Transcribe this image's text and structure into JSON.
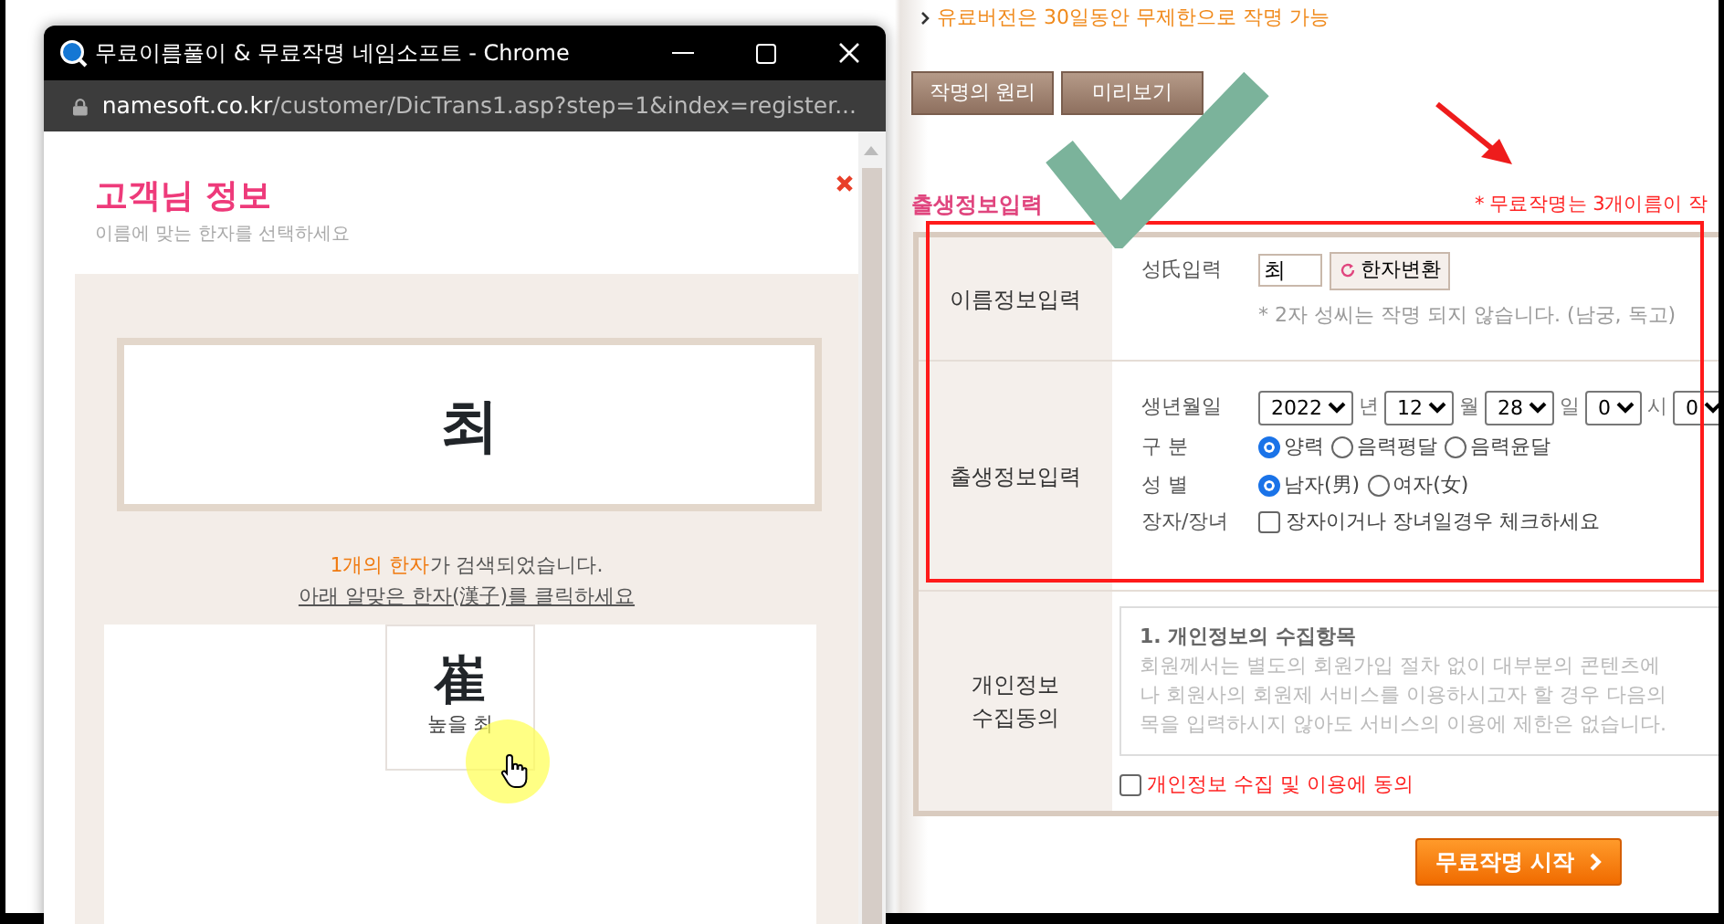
{
  "popup": {
    "title": "무료이름풀이 & 무료작명 네임소프트 - Chrome",
    "url_host": "namesoft.co.kr",
    "url_path": "/customer/DicTrans1.asp?step=1&index=register...",
    "heading": "고객님 정보",
    "subheading": "이름에 맞는 한자를 선택하세요",
    "name_display": "최",
    "result_highlight": "1개의 한자",
    "result_rest": "가 검색되었습니다.",
    "instruction": "아래 알맞은 한자(漢子)를 클릭하세요",
    "hanja": [
      {
        "char": "崔",
        "reading": "높을 최"
      }
    ]
  },
  "page": {
    "notice": "유료버전은 30일동안 무제한으로 작명 가능",
    "buttons": [
      "작명의 원리",
      "미리보기"
    ],
    "section_title": "출생정보입력",
    "free_note": "* 무료작명는 3개이름이 작",
    "name_section": {
      "label": "이름정보입력",
      "field_label": "성氏입력",
      "surname": "최",
      "convert_button": "한자변환",
      "note": "* 2자 성씨는 작명 되지 않습니다. (남궁, 독고)"
    },
    "birth_section": {
      "label": "출생정보입력",
      "date_label": "생년월일",
      "date_parts": [
        {
          "value": "2022",
          "unit": "년"
        },
        {
          "value": "12",
          "unit": "월"
        },
        {
          "value": "28",
          "unit": "일"
        },
        {
          "value": "0",
          "unit": "시"
        },
        {
          "value": "0"
        }
      ],
      "calendar_label": "구 분",
      "calendar_options": [
        {
          "label": "양력",
          "selected": true
        },
        {
          "label": "음력평달",
          "selected": false
        },
        {
          "label": "음력윤달",
          "selected": false
        }
      ],
      "gender_label": "성 별",
      "gender_options": [
        {
          "label": "남자(男)",
          "selected": true
        },
        {
          "label": "여자(女)",
          "selected": false
        }
      ],
      "firstborn_label": "장자/장녀",
      "firstborn": {
        "label": "장자이거나 장녀일경우 체크하세요",
        "checked": false
      }
    },
    "consent_section": {
      "label_lines": [
        "개인정보",
        "수집동의"
      ],
      "terms_title": "1. 개인정보의 수집항목",
      "terms_lines": [
        "회원께서는 별도의 회원가입 절차 없이 대부분의 콘텐츠에",
        "나 회원사의 회원제 서비스를 이용하시고자 할 경우 다음의",
        "목을 입력하시지 않아도 서비스의 이용에 제한은 없습니다."
      ],
      "agree": {
        "label": "개인정보 수집 및 이용에 동의",
        "checked": false
      }
    },
    "submit_button": "무료작명 시작"
  }
}
